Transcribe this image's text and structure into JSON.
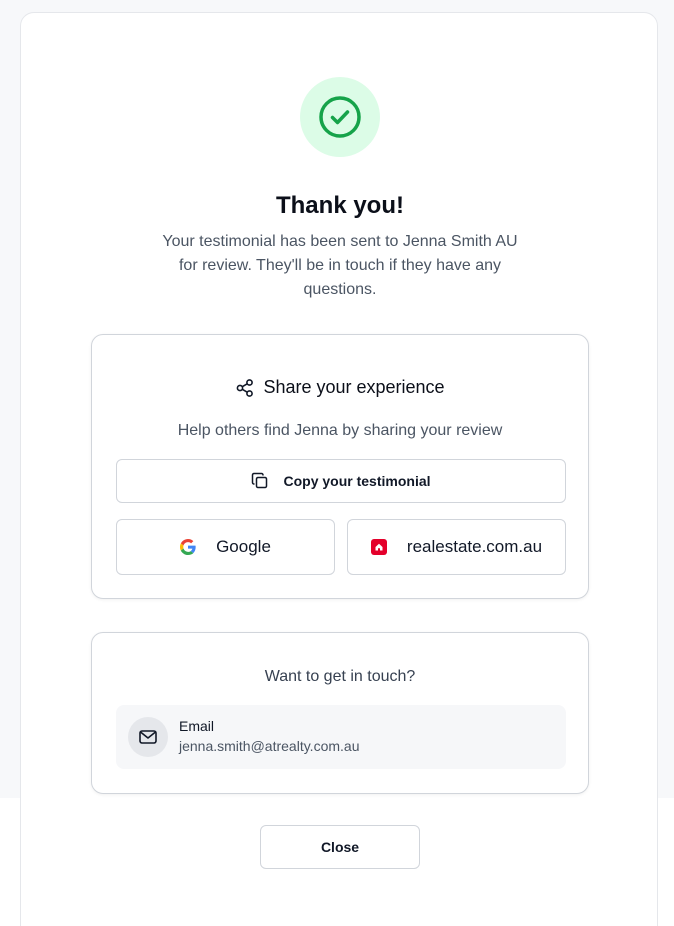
{
  "dialog": {
    "title": "Thank you!",
    "subtitle": "Your testimonial has been sent to Jenna Smith AU for review. They'll be in touch if they have any questions.",
    "success_icon": "check-circle-icon",
    "accent_color": "#16a34a"
  },
  "share": {
    "title": "Share your experience",
    "description": "Help others find Jenna by sharing your review",
    "copy_label": "Copy your testimonial",
    "platforms": [
      {
        "label": "Google",
        "icon": "google-icon"
      },
      {
        "label": "realestate.com.au",
        "icon": "realestate-icon",
        "brand_color": "#e4002b"
      }
    ]
  },
  "contact": {
    "title": "Want to get in touch?",
    "items": [
      {
        "label": "Email",
        "value": "jenna.smith@atrealty.com.au",
        "icon": "mail-icon"
      }
    ]
  },
  "footer": {
    "close_label": "Close"
  }
}
